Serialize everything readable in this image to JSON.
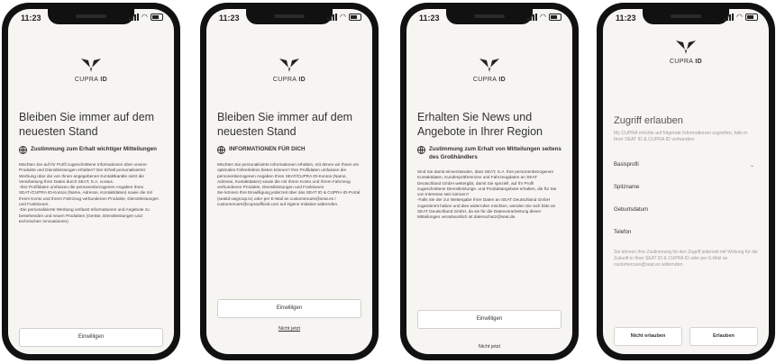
{
  "status_time": "11:23",
  "brand": {
    "prefix": "CUPRA",
    "suffix": "ID"
  },
  "screens": [
    {
      "title": "Bleiben Sie immer auf dem neuesten Stand",
      "subtitle": "Zustimmung zum Erhalt wichtiger Mitteilungen",
      "paragraphs": [
        "Möchten Sie auf Ihr Profil zugeschnittene Informationen über unsere Produkte und Dienstleistungen erhalten? Der Erhalt personalisierter Werbung über die von Ihnen angegebenen Kontaktkanäle setzt die Verarbeitung Ihrer Daten durch SEAT, S.A. voraus.",
        "-Ihre Profildaten umfassen die personenbezogenen Angaben Ihres SEAT-/CUPRA ID-Kontos (Name, Adresse, Kontaktdaten) sowie die mit Ihrem Konto und Ihrem Fahrzeug verbundenen Produkte, Dienstleistungen und Funktionen.",
        "-Die personalisierte Werbung umfasst Informationen und Angebote zu bestehenden und neuen Produkten (Geräte, Dienstleistungen und technischen Innovationen)."
      ],
      "primary_button": "Einwilligen"
    },
    {
      "title": "Bleiben Sie immer auf dem neuesten Stand",
      "subtitle": "INFORMATIONEN FÜR DICH",
      "paragraphs": [
        "Möchten Sie personalisierte Informationen erhalten, mit denen wir Ihnen ein optimales Fahrerlebnis bieten können? Ihre Profildaten umfassen die personenbezogenen Angaben Ihres SEAT/CUPRA ID-Kontos (Name, Adresse, Kontaktdaten) sowie die mit Ihrem Konto und Ihrem Fahrzeug verbundenen Produkte, Dienstleistungen und Funktionen.",
        "Sie können Ihre Einwilligung jederzeit über das SEAT ID & CUPRA ID-Portal (seatid.vwgroup.io) oder per E-Mail an customercare@seat.es / customercare@cupraofficial.com auf eigene Initiative widerrufen."
      ],
      "primary_button": "Einwilligen",
      "secondary_link": "Nicht jetzt"
    },
    {
      "title": "Erhalten Sie News und Angebote in Ihrer Region",
      "subtitle": "Zustimmung zum Erhalt von Mitteilungen seitens des Großhändlers",
      "paragraphs": [
        "Sind Sie damit einverstanden, dass SEAT, S.A. Ihre personenbezogenen Kontaktdaten, Kundenpräferenzen und Fahrzeugdaten an SEAT Deutschland GmbH weitergibt, damit Sie speziell, auf Ihr Profil zugeschnittene Dienstleistungs- und Produktangebote erhalten, die für Sie von Interesse sein können?",
        "-Falls Sie der zur Weitergabe Ihrer Daten an SEAT Deutschland GmbH zugestimmt haben und dies widerrufen möchten, wenden Sie sich bitte an SEAT Deutschland GmbH, da sie für die Datenverarbeitung dieser Mitteilungen verantwortlich ist datenschutz@seat.de."
      ],
      "primary_button": "Einwilligen",
      "secondary_link": "Nicht jetzt"
    },
    {
      "title": "Zugriff erlauben",
      "intro": "My CUPRA möchte auf folgende Informationen zugreifen, falls in Ihrer SEAT ID & CUPRA ID vorhanden:",
      "fields": [
        "Basisprofil",
        "Spitzname",
        "Geburtsdatum",
        "Telefon"
      ],
      "note": "Sie können Ihre Zustimmung für den Zugriff jederzeit mit Wirkung für die Zukunft in Ihrer SEAT ID & CUPRA ID oder per E-Mail an customercare@seat.es widerrufen.",
      "deny_button": "Nicht erlauben",
      "allow_button": "Erlauben"
    }
  ]
}
